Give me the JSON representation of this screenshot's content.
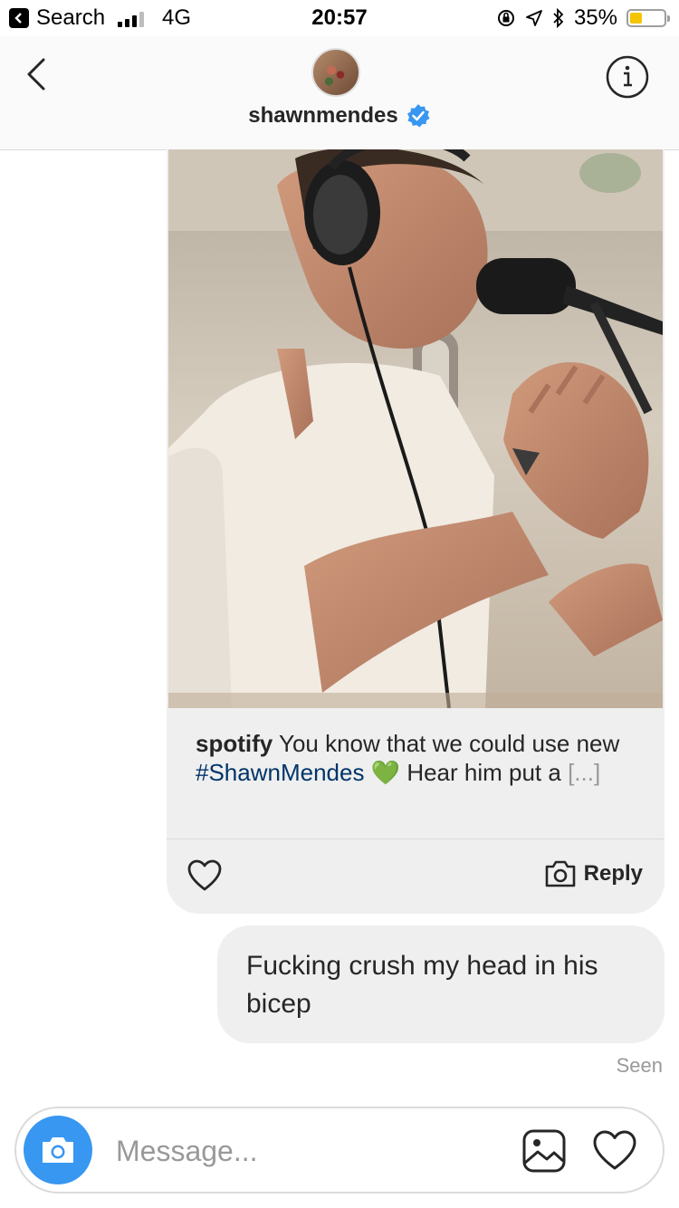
{
  "status_bar": {
    "back_app": "Search",
    "network": "4G",
    "time": "20:57",
    "battery": "35%",
    "battery_level": 0.35,
    "battery_color": "#f5c400"
  },
  "header": {
    "username": "shawnmendes",
    "verified": true,
    "verified_color": "#3897f0"
  },
  "post": {
    "image_icon": "photo-of-singer-at-microphone",
    "caption_user": "spotify",
    "caption_text_1": "You know that we could use new",
    "caption_hashtag": "#ShawnMendes",
    "caption_emoji": "💚",
    "caption_text_2": "Hear him put a",
    "caption_more": "[...]",
    "reply_label": "Reply"
  },
  "message": {
    "text": "Fucking crush my head in his bicep",
    "seen_label": "Seen"
  },
  "composer": {
    "placeholder": "Message...",
    "accent": "#3897f0"
  }
}
